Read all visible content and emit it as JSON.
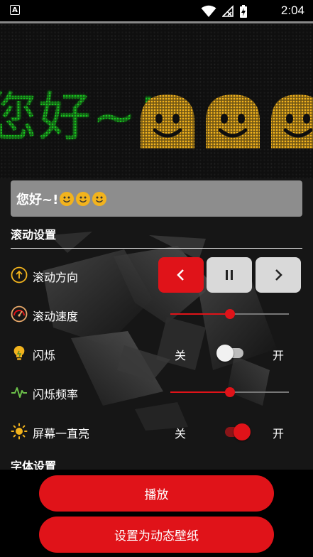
{
  "status_bar": {
    "left_icon": "a-notification-icon",
    "left_icon_glyph": "A",
    "icons": [
      "wifi-icon",
      "signal-off-icon",
      "battery-charging-icon"
    ],
    "time": "2:04"
  },
  "led_display": {
    "text": "您好~!",
    "emoji_count": 3,
    "text_color": "#19c21e",
    "emoji_color": "#f2b31d"
  },
  "input": {
    "value": "您好~!",
    "emoji_count": 3
  },
  "scroll_settings": {
    "title": "滚动设置",
    "direction": {
      "label": "滚动方向",
      "icon": "arrow-up-circle-icon",
      "buttons": [
        "left",
        "pause",
        "right"
      ],
      "active": "left"
    },
    "speed": {
      "label": "滚动速度",
      "icon": "speedometer-icon",
      "value": 0.5
    },
    "blink": {
      "label": "闪烁",
      "icon": "lightbulb-icon",
      "off_label": "关",
      "on_label": "开",
      "on": false
    },
    "blink_freq": {
      "label": "闪烁频率",
      "icon": "pulse-wave-icon",
      "value": 0.5
    },
    "screen_on": {
      "label": "屏幕一直亮",
      "icon": "sun-icon",
      "off_label": "关",
      "on_label": "开",
      "on": true
    }
  },
  "font_settings": {
    "title": "字体设置"
  },
  "buttons": {
    "play": "播放",
    "set_wallpaper": "设置为动态壁纸"
  },
  "colors": {
    "accent": "#e01319",
    "input_bg": "#8d8d8d"
  }
}
